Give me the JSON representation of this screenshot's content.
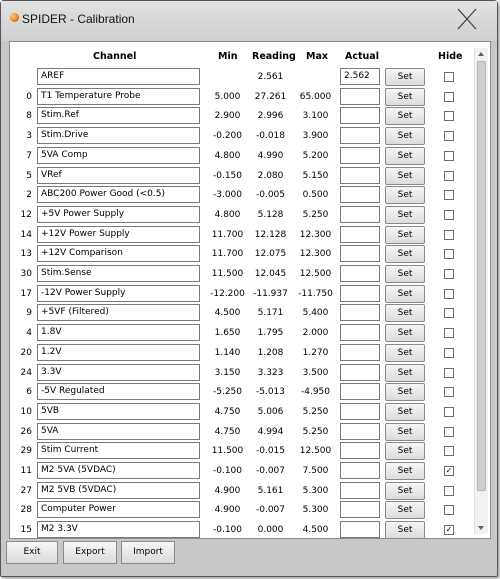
{
  "window": {
    "title": "SPIDER - Calibration"
  },
  "headers": {
    "channel": "Channel",
    "min": "Min",
    "reading": "Reading",
    "max": "Max",
    "actual": "Actual",
    "hide": "Hide"
  },
  "rows": [
    {
      "channel": "",
      "name": "AREF",
      "min": "",
      "reading": "2.561",
      "max": "",
      "actual": "2.562",
      "set": "Set",
      "hide": false
    },
    {
      "channel": "0",
      "name": "T1 Temperature Probe",
      "min": "5.000",
      "reading": "27.261",
      "max": "65.000",
      "actual": "",
      "set": "Set",
      "hide": false
    },
    {
      "channel": "8",
      "name": "Stim.Ref",
      "min": "2.900",
      "reading": "2.996",
      "max": "3.100",
      "actual": "",
      "set": "Set",
      "hide": false
    },
    {
      "channel": "3",
      "name": "Stim.Drive",
      "min": "-0.200",
      "reading": "-0.018",
      "max": "3.900",
      "actual": "",
      "set": "Set",
      "hide": false
    },
    {
      "channel": "7",
      "name": "5VA Comp",
      "min": "4.800",
      "reading": "4.990",
      "max": "5.200",
      "actual": "",
      "set": "Set",
      "hide": false
    },
    {
      "channel": "5",
      "name": "VRef",
      "min": "-0.150",
      "reading": "2.080",
      "max": "5.150",
      "actual": "",
      "set": "Set",
      "hide": false
    },
    {
      "channel": "2",
      "name": "ABC200 Power Good (<0.5)",
      "min": "-3.000",
      "reading": "-0.005",
      "max": "0.500",
      "actual": "",
      "set": "Set",
      "hide": false
    },
    {
      "channel": "12",
      "name": "+5V Power Supply",
      "min": "4.800",
      "reading": "5.128",
      "max": "5.250",
      "actual": "",
      "set": "Set",
      "hide": false
    },
    {
      "channel": "14",
      "name": "+12V Power Supply",
      "min": "11.700",
      "reading": "12.128",
      "max": "12.300",
      "actual": "",
      "set": "Set",
      "hide": false
    },
    {
      "channel": "13",
      "name": "+12V Comparison",
      "min": "11.700",
      "reading": "12.075",
      "max": "12.300",
      "actual": "",
      "set": "Set",
      "hide": false
    },
    {
      "channel": "30",
      "name": "Stim.Sense",
      "min": "11.500",
      "reading": "12.045",
      "max": "12.500",
      "actual": "",
      "set": "Set",
      "hide": false
    },
    {
      "channel": "17",
      "name": "-12V Power Supply",
      "min": "-12.200",
      "reading": "-11.937",
      "max": "-11.750",
      "actual": "",
      "set": "Set",
      "hide": false
    },
    {
      "channel": "9",
      "name": "+5VF (Filtered)",
      "min": "4.500",
      "reading": "5.171",
      "max": "5.400",
      "actual": "",
      "set": "Set",
      "hide": false
    },
    {
      "channel": "4",
      "name": "1.8V",
      "min": "1.650",
      "reading": "1.795",
      "max": "2.000",
      "actual": "",
      "set": "Set",
      "hide": false
    },
    {
      "channel": "20",
      "name": "1.2V",
      "min": "1.140",
      "reading": "1.208",
      "max": "1.270",
      "actual": "",
      "set": "Set",
      "hide": false
    },
    {
      "channel": "24",
      "name": "3.3V",
      "min": "3.150",
      "reading": "3.323",
      "max": "3.500",
      "actual": "",
      "set": "Set",
      "hide": false
    },
    {
      "channel": "6",
      "name": "-5V Regulated",
      "min": "-5.250",
      "reading": "-5.013",
      "max": "-4.950",
      "actual": "",
      "set": "Set",
      "hide": false
    },
    {
      "channel": "10",
      "name": "5VB",
      "min": "4.750",
      "reading": "5.006",
      "max": "5.250",
      "actual": "",
      "set": "Set",
      "hide": false
    },
    {
      "channel": "26",
      "name": "5VA",
      "min": "4.750",
      "reading": "4.994",
      "max": "5.250",
      "actual": "",
      "set": "Set",
      "hide": false
    },
    {
      "channel": "29",
      "name": "Stim Current",
      "min": "11.500",
      "reading": "-0.015",
      "max": "12.500",
      "actual": "",
      "set": "Set",
      "hide": false
    },
    {
      "channel": "11",
      "name": "M2 5VA (5VDAC)",
      "min": "-0.100",
      "reading": "-0.007",
      "max": "7.500",
      "actual": "",
      "set": "Set",
      "hide": true
    },
    {
      "channel": "27",
      "name": "M2 5VB (5VDAC)",
      "min": "4.900",
      "reading": "5.161",
      "max": "5.300",
      "actual": "",
      "set": "Set",
      "hide": false
    },
    {
      "channel": "28",
      "name": "Computer Power",
      "min": "4.900",
      "reading": "-0.007",
      "max": "5.300",
      "actual": "",
      "set": "Set",
      "hide": false
    },
    {
      "channel": "15",
      "name": "M2 3.3V",
      "min": "-0.100",
      "reading": "0.000",
      "max": "4.500",
      "actual": "",
      "set": "Set",
      "hide": true
    }
  ],
  "buttons": {
    "exit": "Exit",
    "export": "Export",
    "import": "Import"
  },
  "icons": {
    "close": "close-x-icon",
    "app": "spider-app-icon",
    "check": "✓"
  }
}
